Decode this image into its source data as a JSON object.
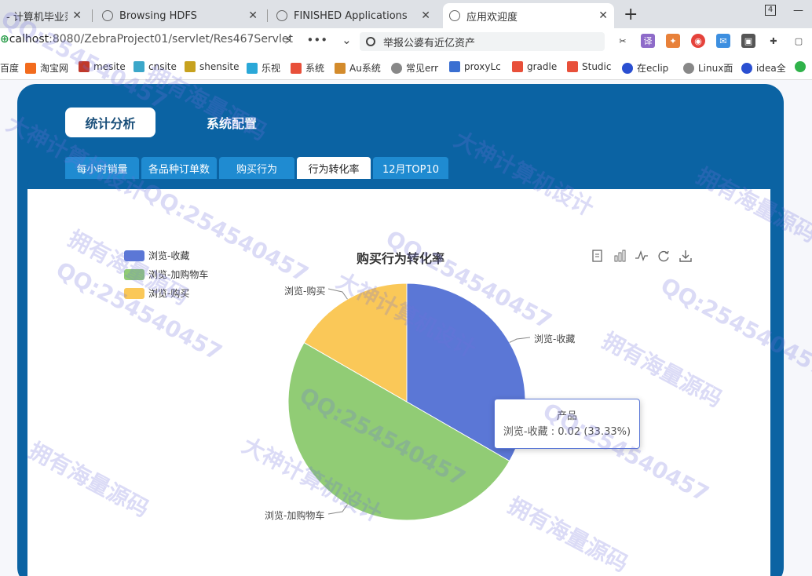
{
  "browser": {
    "tabs": [
      {
        "label": "- 计算机毕业范",
        "active": false
      },
      {
        "label": "Browsing HDFS",
        "active": false
      },
      {
        "label": "FINISHED Applications",
        "active": false
      },
      {
        "label": "应用欢迎度",
        "active": true
      }
    ],
    "url_host": "calhost",
    "url_rest": ":8080/ZebraProject01/servlet/Res467Servlet",
    "search_text": "举报公婆有近亿资产",
    "bookmarks": [
      "百度",
      "淘宝网",
      "mesite",
      "cnsite",
      "shensite",
      "乐视",
      "系统",
      "Au系统",
      "常见err",
      "proxyLc",
      "gradle",
      "Studic",
      "在eclip",
      "Linux面",
      "idea全"
    ]
  },
  "app": {
    "nav": {
      "stat_label": "统计分析",
      "sys_label": "系统配置"
    },
    "subtabs": [
      "每小时销量",
      "各品种订单数",
      "购买行为",
      "行为转化率",
      "12月TOP10"
    ],
    "active_subtab": 3
  },
  "chart_data": {
    "type": "pie",
    "title": "购买行为转化率",
    "legend_position": "top-left",
    "slices": [
      {
        "name": "浏览-收藏",
        "value": 0.02,
        "percent": 33.33,
        "color": "#5b77d6"
      },
      {
        "name": "浏览-加购物车",
        "value": 0.03,
        "percent": 50.0,
        "color": "#91cc75"
      },
      {
        "name": "浏览-购买",
        "value": 0.01,
        "percent": 16.67,
        "color": "#fac858"
      }
    ],
    "tooltip": {
      "title": "产品",
      "text": "浏览-收藏 : 0.02 (33.33%)"
    }
  },
  "watermarks": [
    "拥有海量源码",
    "大神计算机设计",
    "QQ:254540457"
  ]
}
